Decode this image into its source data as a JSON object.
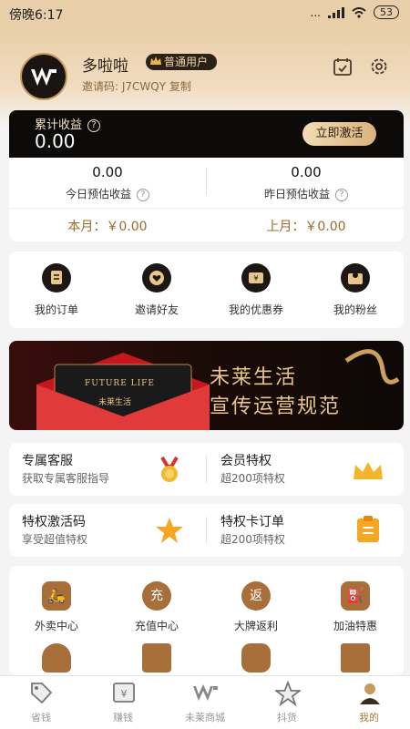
{
  "status": {
    "time": "傍晚6:17",
    "signal_text": "...",
    "battery": "53"
  },
  "profile": {
    "name": "多啦啦",
    "badge": "普通用户",
    "invite_label": "邀请码:",
    "invite_code": "J7CWQY",
    "copy": "复制"
  },
  "earnings": {
    "label": "累计收益",
    "value": "0.00",
    "activate_button": "立即激活"
  },
  "stats": {
    "today_value": "0.00",
    "today_label": "今日预估收益",
    "yesterday_value": "0.00",
    "yesterday_label": "昨日预估收益",
    "month": "本月：￥0.00",
    "last_month": "上月：￥0.00"
  },
  "quick_actions": [
    {
      "label": "我的订单",
      "icon": "order-icon"
    },
    {
      "label": "邀请好友",
      "icon": "heart-icon"
    },
    {
      "label": "我的优惠券",
      "icon": "coupon-icon"
    },
    {
      "label": "我的粉丝",
      "icon": "fans-icon"
    }
  ],
  "banner": {
    "title1": "未莱生活",
    "title2": "宣传运营规范",
    "card_text": "FUTURE LIFE",
    "card_sub": "未莱生活"
  },
  "services": [
    {
      "title": "专属客服",
      "sub": "获取专属客服指导",
      "icon": "medal-icon"
    },
    {
      "title": "会员特权",
      "sub": "超200项特权",
      "icon": "crown-icon"
    },
    {
      "title": "特权激活码",
      "sub": "享受超值特权",
      "icon": "star-icon"
    },
    {
      "title": "特权卡订单",
      "sub": "超200项特权",
      "icon": "clipboard-icon"
    }
  ],
  "grid": [
    {
      "label": "外卖中心",
      "icon": "delivery-icon",
      "glyph": "🛵"
    },
    {
      "label": "充值中心",
      "icon": "recharge-icon",
      "glyph": "充"
    },
    {
      "label": "大牌返利",
      "icon": "rebate-icon",
      "glyph": "返"
    },
    {
      "label": "加油特惠",
      "icon": "fuel-icon",
      "glyph": "⛽"
    }
  ],
  "tabs": [
    {
      "label": "省钱",
      "icon": "tag-icon",
      "active": false
    },
    {
      "label": "赚钱",
      "icon": "money-icon",
      "active": false
    },
    {
      "label": "未莱商城",
      "icon": "mall-logo-icon",
      "active": false
    },
    {
      "label": "抖货",
      "icon": "star-tab-icon",
      "active": false
    },
    {
      "label": "我的",
      "icon": "profile-icon",
      "active": true
    }
  ],
  "colors": {
    "gold": "#c79a5a",
    "dark": "#0c0b0a",
    "accent_text": "#9a6a2a"
  }
}
